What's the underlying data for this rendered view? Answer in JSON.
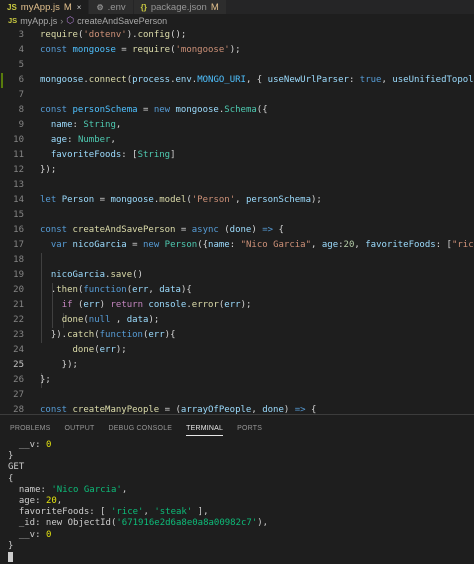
{
  "tabs": [
    {
      "icon": "JS",
      "label": "myApp.js",
      "modified": "M",
      "active": true,
      "close": "×"
    },
    {
      "icon": "⚙",
      "label": ".env",
      "active": false
    },
    {
      "icon": "{}",
      "label": "package.json",
      "modified": "M",
      "active": false
    }
  ],
  "breadcrumb": {
    "icon": "JS",
    "file": "myApp.js",
    "symbol": "createAndSavePerson"
  },
  "editor": {
    "current_line": 25,
    "lines": [
      {
        "n": "3",
        "t": [
          [
            "fn",
            "require"
          ],
          [
            "",
            "("
          ],
          [
            "str",
            "'dotenv'"
          ],
          [
            "",
            ")."
          ],
          [
            "fn",
            "config"
          ],
          [
            "",
            "();"
          ]
        ]
      },
      {
        "n": "4",
        "t": [
          [
            "kw",
            "const "
          ],
          [
            "cst",
            "mongoose"
          ],
          [
            "",
            " = "
          ],
          [
            "fn",
            "require"
          ],
          [
            "",
            "("
          ],
          [
            "str",
            "'mongoose'"
          ],
          [
            "",
            ");"
          ]
        ]
      },
      {
        "n": "5",
        "t": []
      },
      {
        "n": "6",
        "t": [
          [
            "var",
            "mongoose"
          ],
          [
            "",
            "."
          ],
          [
            "fn",
            "connect"
          ],
          [
            "",
            "("
          ],
          [
            "var",
            "process"
          ],
          [
            "",
            "."
          ],
          [
            "var",
            "env"
          ],
          [
            "",
            "."
          ],
          [
            "cst",
            "MONGO_URI"
          ],
          [
            "",
            ", { "
          ],
          [
            "var",
            "useNewUrlParser"
          ],
          [
            "",
            ": "
          ],
          [
            "kw",
            "true"
          ],
          [
            "",
            ", "
          ],
          [
            "var",
            "useUnifiedTopology"
          ],
          [
            "",
            ": "
          ],
          [
            "kw",
            "true"
          ],
          [
            "",
            " }"
          ]
        ]
      },
      {
        "n": "7",
        "t": []
      },
      {
        "n": "8",
        "t": [
          [
            "kw",
            "const "
          ],
          [
            "cst",
            "personSchema"
          ],
          [
            "",
            " = "
          ],
          [
            "kw",
            "new "
          ],
          [
            "var",
            "mongoose"
          ],
          [
            "",
            "."
          ],
          [
            "cls",
            "Schema"
          ],
          [
            "",
            "({"
          ]
        ]
      },
      {
        "n": "9",
        "t": [
          [
            "",
            "  "
          ],
          [
            "var",
            "name"
          ],
          [
            "",
            ": "
          ],
          [
            "cls",
            "String"
          ],
          [
            "",
            ","
          ]
        ]
      },
      {
        "n": "10",
        "t": [
          [
            "",
            "  "
          ],
          [
            "var",
            "age"
          ],
          [
            "",
            ": "
          ],
          [
            "cls",
            "Number"
          ],
          [
            "",
            ","
          ]
        ]
      },
      {
        "n": "11",
        "t": [
          [
            "",
            "  "
          ],
          [
            "var",
            "favoriteFoods"
          ],
          [
            "",
            ": ["
          ],
          [
            "cls",
            "String"
          ],
          [
            "",
            "]"
          ]
        ]
      },
      {
        "n": "12",
        "t": [
          [
            "",
            "});"
          ]
        ]
      },
      {
        "n": "13",
        "t": []
      },
      {
        "n": "14",
        "t": [
          [
            "kw",
            "let "
          ],
          [
            "var",
            "Person"
          ],
          [
            "",
            " = "
          ],
          [
            "var",
            "mongoose"
          ],
          [
            "",
            "."
          ],
          [
            "fn",
            "model"
          ],
          [
            "",
            "("
          ],
          [
            "str",
            "'Person'"
          ],
          [
            "",
            ", "
          ],
          [
            "var",
            "personSchema"
          ],
          [
            "",
            ");"
          ]
        ]
      },
      {
        "n": "15",
        "t": []
      },
      {
        "n": "16",
        "t": [
          [
            "kw",
            "const "
          ],
          [
            "fn",
            "createAndSavePerson"
          ],
          [
            "",
            " = "
          ],
          [
            "kw",
            "async "
          ],
          [
            "",
            "("
          ],
          [
            "var",
            "done"
          ],
          [
            "",
            ") "
          ],
          [
            "kw",
            "=>"
          ],
          [
            "",
            " {"
          ]
        ]
      },
      {
        "n": "17",
        "t": [
          [
            "",
            "  "
          ],
          [
            "kw",
            "var "
          ],
          [
            "var",
            "nicoGarcia"
          ],
          [
            "",
            " = "
          ],
          [
            "kw",
            "new "
          ],
          [
            "cls",
            "Person"
          ],
          [
            "",
            "({"
          ],
          [
            "var",
            "name"
          ],
          [
            "",
            ": "
          ],
          [
            "str",
            "\"Nico Garcia\""
          ],
          [
            "",
            ", "
          ],
          [
            "var",
            "age"
          ],
          [
            "",
            ":"
          ],
          [
            "num",
            "20"
          ],
          [
            "",
            ", "
          ],
          [
            "var",
            "favoriteFoods"
          ],
          [
            "",
            ": ["
          ],
          [
            "str",
            "\"rice\""
          ],
          [
            "",
            ", "
          ],
          [
            "str",
            "\"steak\""
          ],
          [
            "",
            "]"
          ]
        ]
      },
      {
        "n": "18",
        "t": []
      },
      {
        "n": "19",
        "t": [
          [
            "",
            "  "
          ],
          [
            "var",
            "nicoGarcia"
          ],
          [
            "",
            "."
          ],
          [
            "fn",
            "save"
          ],
          [
            "",
            "()"
          ]
        ]
      },
      {
        "n": "20",
        "t": [
          [
            "",
            "  ."
          ],
          [
            "fn",
            "then"
          ],
          [
            "",
            "("
          ],
          [
            "kw",
            "function"
          ],
          [
            "",
            "("
          ],
          [
            "var",
            "err"
          ],
          [
            "",
            ", "
          ],
          [
            "var",
            "data"
          ],
          [
            "",
            "){"
          ]
        ]
      },
      {
        "n": "21",
        "t": [
          [
            "",
            "    "
          ],
          [
            "ctl",
            "if"
          ],
          [
            "",
            " ("
          ],
          [
            "var",
            "err"
          ],
          [
            "",
            ") "
          ],
          [
            "ctl",
            "return "
          ],
          [
            "var",
            "console"
          ],
          [
            "",
            "."
          ],
          [
            "fn",
            "error"
          ],
          [
            "",
            "("
          ],
          [
            "var",
            "err"
          ],
          [
            "",
            ");"
          ]
        ]
      },
      {
        "n": "22",
        "t": [
          [
            "",
            "    "
          ],
          [
            "fn",
            "done"
          ],
          [
            "",
            "("
          ],
          [
            "kw",
            "null"
          ],
          [
            "",
            " , "
          ],
          [
            "var",
            "data"
          ],
          [
            "",
            ");"
          ]
        ]
      },
      {
        "n": "23",
        "t": [
          [
            "",
            "  })."
          ],
          [
            "fn",
            "catch"
          ],
          [
            "",
            "("
          ],
          [
            "kw",
            "function"
          ],
          [
            "",
            "("
          ],
          [
            "var",
            "err"
          ],
          [
            "",
            "){"
          ]
        ]
      },
      {
        "n": "24",
        "t": [
          [
            "",
            "      "
          ],
          [
            "fn",
            "done"
          ],
          [
            "",
            "("
          ],
          [
            "var",
            "err"
          ],
          [
            "",
            ");"
          ]
        ]
      },
      {
        "n": "25",
        "t": [
          [
            "",
            "    });"
          ]
        ]
      },
      {
        "n": "26",
        "t": [
          [
            "",
            "};"
          ]
        ]
      },
      {
        "n": "27",
        "t": []
      },
      {
        "n": "28",
        "t": [
          [
            "kw",
            "const "
          ],
          [
            "fn",
            "createManyPeople"
          ],
          [
            "",
            " = ("
          ],
          [
            "var",
            "arrayOfPeople"
          ],
          [
            "",
            ", "
          ],
          [
            "var",
            "done"
          ],
          [
            "",
            ") "
          ],
          [
            "kw",
            "=>"
          ],
          [
            "",
            " {"
          ]
        ]
      },
      {
        "n": "29",
        "t": [
          [
            "",
            "  "
          ],
          [
            "fn",
            "done"
          ],
          [
            "",
            "("
          ],
          [
            "kw",
            "null"
          ],
          [
            "",
            " "
          ],
          [
            "com",
            "/*, data*/"
          ],
          [
            "",
            ");"
          ]
        ]
      },
      {
        "n": "30",
        "t": [
          [
            "",
            "};"
          ]
        ]
      },
      {
        "n": "31",
        "t": []
      },
      {
        "n": "32",
        "t": [
          [
            "kw",
            "const "
          ],
          [
            "fn",
            "findPeopleByName"
          ],
          [
            "",
            " = ("
          ],
          [
            "var",
            "personName"
          ],
          [
            "",
            ", "
          ],
          [
            "var",
            "done"
          ],
          [
            "",
            ") "
          ],
          [
            "kw",
            "=>"
          ],
          [
            "",
            " {"
          ]
        ]
      },
      {
        "n": "33",
        "t": [
          [
            "",
            "  "
          ],
          [
            "fn",
            "done"
          ],
          [
            "",
            "("
          ],
          [
            "kw",
            "null"
          ],
          [
            "",
            " "
          ],
          [
            "com",
            "/*, data*/"
          ],
          [
            "",
            ");"
          ]
        ]
      },
      {
        "n": "34",
        "t": [
          [
            "",
            "};"
          ]
        ]
      },
      {
        "n": "35",
        "t": []
      }
    ]
  },
  "panel": {
    "tabs": [
      "PROBLEMS",
      "OUTPUT",
      "DEBUG CONSOLE",
      "TERMINAL",
      "PORTS"
    ],
    "active_tab": "TERMINAL"
  },
  "terminal": {
    "lines": [
      [
        [
          "",
          "  __v: "
        ],
        [
          "tnum",
          "0"
        ]
      ],
      [
        [
          "",
          "}"
        ]
      ],
      [
        [
          "",
          "GET"
        ]
      ],
      [
        [
          "",
          "{"
        ]
      ],
      [
        [
          "",
          "  name: "
        ],
        [
          "tstr",
          "'Nico Garcia'"
        ],
        [
          "",
          ","
        ]
      ],
      [
        [
          "",
          "  age: "
        ],
        [
          "tnum",
          "20"
        ],
        [
          "",
          ","
        ]
      ],
      [
        [
          "",
          "  favoriteFoods: [ "
        ],
        [
          "tstr",
          "'rice'"
        ],
        [
          "",
          ", "
        ],
        [
          "tstr",
          "'steak'"
        ],
        [
          "",
          " ],"
        ]
      ],
      [
        [
          "",
          "  _id: new ObjectId("
        ],
        [
          "tstr",
          "'671916e2d6a8e0a8a00982c7'"
        ],
        [
          "",
          "),"
        ]
      ],
      [
        [
          "",
          "  __v: "
        ],
        [
          "tnum",
          "0"
        ]
      ],
      [
        [
          "",
          "}"
        ]
      ]
    ]
  }
}
